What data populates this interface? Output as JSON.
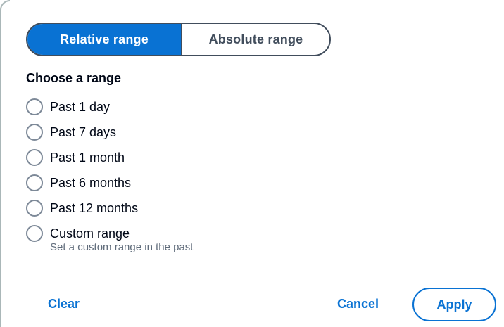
{
  "tabs": {
    "relative_label": "Relative range",
    "absolute_label": "Absolute range",
    "selected": "Relative range"
  },
  "section_title": "Choose a range",
  "options": [
    {
      "label": "Past 1 day",
      "selected": false
    },
    {
      "label": "Past 7 days",
      "selected": false
    },
    {
      "label": "Past 1 month",
      "selected": false
    },
    {
      "label": "Past 6 months",
      "selected": false
    },
    {
      "label": "Past 12 months",
      "selected": false
    },
    {
      "label": "Custom range",
      "selected": false,
      "description": "Set a custom range in the past"
    }
  ],
  "footer": {
    "clear_label": "Clear",
    "cancel_label": "Cancel",
    "apply_label": "Apply"
  },
  "colors": {
    "accent": "#0972d3",
    "segment_border": "#414d5c",
    "radio_border": "#7d8998",
    "text_primary": "#000716",
    "text_secondary": "#5f6b7a"
  },
  "icons": {
    "radio": "radio-unchecked-icon"
  }
}
